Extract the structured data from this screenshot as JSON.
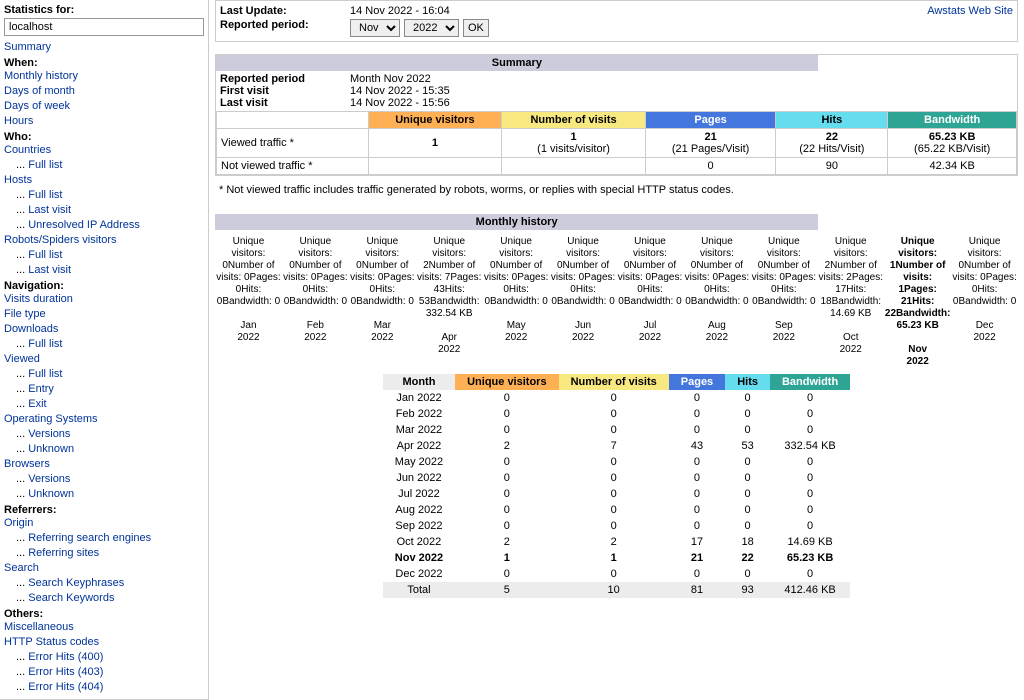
{
  "sidebar": {
    "stats_for_label": "Statistics for:",
    "host": "localhost",
    "summary": "Summary",
    "when_hdr": "When:",
    "when": {
      "monthly": "Monthly history",
      "daysm": "Days of month",
      "daysw": "Days of week",
      "hours": "Hours"
    },
    "who_hdr": "Who:",
    "who": {
      "countries": "Countries",
      "fulllist": "Full list",
      "hosts": "Hosts",
      "lastvisit": "Last visit",
      "unresolved": "Unresolved IP Address",
      "robots": "Robots/Spiders visitors"
    },
    "nav_hdr": "Navigation:",
    "nav": {
      "visitsdur": "Visits duration",
      "filetype": "File type",
      "downloads": "Downloads",
      "fulllist": "Full list",
      "viewed": "Viewed",
      "entry": "Entry",
      "exit": "Exit",
      "os": "Operating Systems",
      "versions": "Versions",
      "unknown": "Unknown",
      "browsers": "Browsers"
    },
    "ref_hdr": "Referrers:",
    "ref": {
      "origin": "Origin",
      "rse": "Referring search engines",
      "rs": "Referring sites",
      "search": "Search",
      "skp": "Search Keyphrases",
      "skw": "Search Keywords"
    },
    "other_hdr": "Others:",
    "other": {
      "misc": "Miscellaneous",
      "httpstatus": "HTTP Status codes",
      "e400": "Error Hits (400)",
      "e403": "Error Hits (403)",
      "e404": "Error Hits (404)"
    },
    "dots": "... "
  },
  "top": {
    "last_update_label": "Last Update:",
    "last_update": "14 Nov 2022 - 16:04",
    "reported_label": "Reported period:",
    "month_value": "Nov",
    "year_value": "2022",
    "ok": "OK",
    "awstats_link": "Awstats Web Site"
  },
  "summary": {
    "title": "Summary",
    "reported_label": "Reported period",
    "reported": "Month Nov 2022",
    "first_visit_label": "First visit",
    "first_visit": "14 Nov 2022 - 15:35",
    "last_visit_label": "Last visit",
    "last_visit": "14 Nov 2022 - 15:56",
    "hdr_uv": "Unique visitors",
    "hdr_nv": "Number of visits",
    "hdr_pg": "Pages",
    "hdr_ht": "Hits",
    "hdr_bw": "Bandwidth",
    "row_viewed": "Viewed traffic *",
    "row_notviewed": "Not viewed traffic *",
    "viewed": {
      "uv": "1",
      "nv": "1",
      "nv_sub": "(1 visits/visitor)",
      "pg": "21",
      "pg_sub": "(21 Pages/Visit)",
      "ht": "22",
      "ht_sub": "(22 Hits/Visit)",
      "bw": "65.23 KB",
      "bw_sub": "(65.22 KB/Visit)"
    },
    "notviewed": {
      "pg": "0",
      "ht": "90",
      "bw": "42.34 KB"
    },
    "footnote": "* Not viewed traffic includes traffic generated by robots, worms, or replies with special HTTP status codes."
  },
  "monthly": {
    "title": "Monthly history",
    "band_labels": {
      "uv": "Unique visitors:",
      "nv": "Number of visits:",
      "pg": "Pages:",
      "ht": "Hits:",
      "bw": "Bandwidth:"
    },
    "table": {
      "hdr": {
        "month": "Month",
        "uv": "Unique visitors",
        "nv": "Number of visits",
        "pg": "Pages",
        "ht": "Hits",
        "bw": "Bandwidth"
      },
      "total_label": "Total",
      "total": {
        "uv": "5",
        "nv": "10",
        "pg": "81",
        "ht": "93",
        "bw": "412.46 KB"
      }
    }
  },
  "chart_data": {
    "type": "table",
    "categories": [
      "Jan 2022",
      "Feb 2022",
      "Mar 2022",
      "Apr 2022",
      "May 2022",
      "Jun 2022",
      "Jul 2022",
      "Aug 2022",
      "Sep 2022",
      "Oct 2022",
      "Nov 2022",
      "Dec 2022"
    ],
    "series": [
      {
        "name": "Unique visitors",
        "values": [
          0,
          0,
          0,
          2,
          0,
          0,
          0,
          0,
          0,
          2,
          1,
          0
        ]
      },
      {
        "name": "Number of visits",
        "values": [
          0,
          0,
          0,
          7,
          0,
          0,
          0,
          0,
          0,
          2,
          1,
          0
        ]
      },
      {
        "name": "Pages",
        "values": [
          0,
          0,
          0,
          43,
          0,
          0,
          0,
          0,
          0,
          17,
          21,
          0
        ]
      },
      {
        "name": "Hits",
        "values": [
          0,
          0,
          0,
          53,
          0,
          0,
          0,
          0,
          0,
          18,
          22,
          0
        ]
      },
      {
        "name": "Bandwidth",
        "values": [
          "0",
          "0",
          "0",
          "332.54 KB",
          "0",
          "0",
          "0",
          "0",
          "0",
          "14.69 KB",
          "65.23 KB",
          "0"
        ]
      }
    ],
    "current_index": 10,
    "totals": {
      "Unique visitors": 5,
      "Number of visits": 10,
      "Pages": 81,
      "Hits": 93,
      "Bandwidth": "412.46 KB"
    }
  }
}
